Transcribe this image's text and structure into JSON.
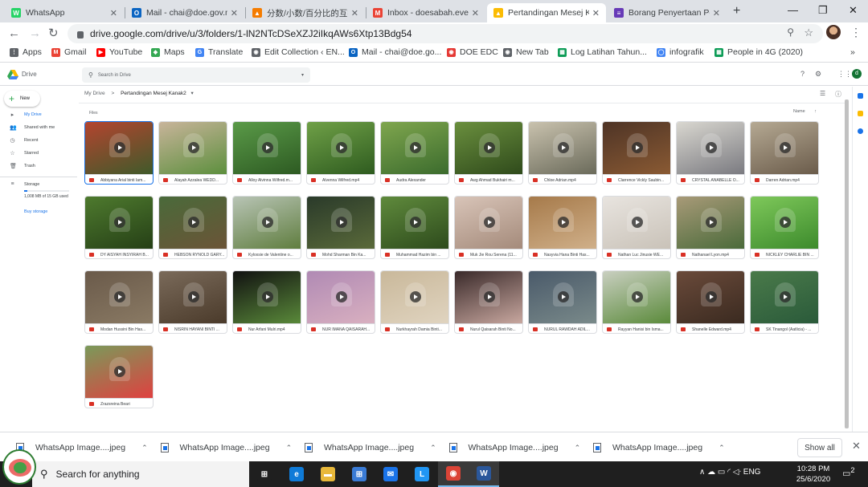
{
  "browser": {
    "tabs": [
      {
        "title": "WhatsApp",
        "icon_color": "#25d366",
        "icon_letter": "W",
        "active": false
      },
      {
        "title": "Mail - chai@doe.gov.m",
        "icon_color": "#0a64c2",
        "icon_letter": "O",
        "active": false
      },
      {
        "title": "分数/小数/百分比的互换",
        "icon_color": "#f57c00",
        "icon_letter": "▲",
        "active": false
      },
      {
        "title": "Inbox - doesabah.event",
        "icon_color": "#ea4335",
        "icon_letter": "M",
        "active": false
      },
      {
        "title": "Pertandingan Mesej Ka",
        "icon_color": "#fbbc04",
        "icon_letter": "▲",
        "active": true
      },
      {
        "title": "Borang Penyertaan Pert",
        "icon_color": "#673ab7",
        "icon_letter": "≡",
        "active": false
      }
    ],
    "new_tab_symbol": "+",
    "window_controls": {
      "minimize": "—",
      "restore": "❐",
      "close": "✕"
    },
    "url": "drive.google.com/drive/u/3/folders/1-lN2NTcDSeXZJ2iIkqAWs6Xtp13Bdg54",
    "bookmarks": [
      {
        "label": "Apps",
        "icon_color": "#5f6368",
        "icon_letter": "⋮"
      },
      {
        "label": "Gmail",
        "icon_color": "#ea4335",
        "icon_letter": "M"
      },
      {
        "label": "YouTube",
        "icon_color": "#ff0000",
        "icon_letter": "▶"
      },
      {
        "label": "Maps",
        "icon_color": "#34a853",
        "icon_letter": "◆"
      },
      {
        "label": "Translate",
        "icon_color": "#4285f4",
        "icon_letter": "G"
      },
      {
        "label": "Edit Collection ‹ EN...",
        "icon_color": "#5f6368",
        "icon_letter": "◉"
      },
      {
        "label": "Mail - chai@doe.go...",
        "icon_color": "#0a64c2",
        "icon_letter": "O"
      },
      {
        "label": "DOE EDC",
        "icon_color": "#e53935",
        "icon_letter": "◉"
      },
      {
        "label": "New Tab",
        "icon_color": "#5f6368",
        "icon_letter": "◉"
      },
      {
        "label": "Log Latihan Tahun...",
        "icon_color": "#0f9d58",
        "icon_letter": "▦"
      },
      {
        "label": "infografik",
        "icon_color": "#4285f4",
        "icon_letter": "◯"
      },
      {
        "label": "People in 4G (2020)",
        "icon_color": "#0f9d58",
        "icon_letter": "▦"
      }
    ],
    "bookmark_overflow": "»"
  },
  "drive": {
    "app_name": "Drive",
    "search_placeholder": "Search in Drive",
    "new_label": "New",
    "sidebar": [
      {
        "label": "My Drive",
        "icon": "▸"
      },
      {
        "label": "Shared with me",
        "icon": "👥"
      },
      {
        "label": "Recent",
        "icon": "◷"
      },
      {
        "label": "Starred",
        "icon": "☆"
      },
      {
        "label": "Trash",
        "icon": "🗑"
      }
    ],
    "storage_label": "Storage",
    "storage_used": "1,008 MB of 15 GB used",
    "storage_fraction": 0.07,
    "buy_storage": "Buy storage",
    "breadcrumb_root": "My Drive",
    "breadcrumb_sep": ">",
    "breadcrumb_current": "Pertandingan Mesej Kanak2",
    "breadcrumb_caret": "▾",
    "files_label": "Files",
    "sort_label": "Name",
    "sort_arrow": "↑",
    "account_letter": "d",
    "files": [
      {
        "name": "Abbiyana Arial binti Iam...",
        "colors": [
          "#b4442f",
          "#3f5a2a"
        ]
      },
      {
        "name": "Alayah Azzalea WEDD...",
        "colors": [
          "#c8b49a",
          "#5c8f3d"
        ]
      },
      {
        "name": "Alloy Alvinna Wilfred.m...",
        "colors": [
          "#5a9a48",
          "#2d5a22"
        ]
      },
      {
        "name": "Alvenna Wilfred.mp4",
        "colors": [
          "#6fa047",
          "#2e5b1f"
        ]
      },
      {
        "name": "Audra Alexander",
        "colors": [
          "#7fa64e",
          "#3b6b2d"
        ]
      },
      {
        "name": "Awg Ahmad Bukhairi m...",
        "colors": [
          "#6a8f3e",
          "#2f4a1b"
        ]
      },
      {
        "name": "Chloe Adrian.mp4",
        "colors": [
          "#c9c2ae",
          "#6a6a5a"
        ]
      },
      {
        "name": "Clarrence Vickly Saubin...",
        "colors": [
          "#4e3426",
          "#8a5a33"
        ]
      },
      {
        "name": "CRYSTAL ANABELLE O...",
        "colors": [
          "#d9d7d0",
          "#7a7a80"
        ]
      },
      {
        "name": "Darren Adrian.mp4",
        "colors": [
          "#b5a993",
          "#6a5b4a"
        ]
      },
      {
        "name": "DY AISYAH INSYIRAH B...",
        "colors": [
          "#4e7a2e",
          "#253f16"
        ]
      },
      {
        "name": "HEBSON RYNOLD GARY...",
        "colors": [
          "#4a6a3a",
          "#6b5437"
        ]
      },
      {
        "name": "Kyloxsie de Valentine o...",
        "colors": [
          "#b8c4b5",
          "#5f7d3e"
        ]
      },
      {
        "name": "Mohd Sharman Bin Ka...",
        "colors": [
          "#2a3a2a",
          "#5a6a3a"
        ]
      },
      {
        "name": "Muhammad Hazim bin ...",
        "colors": [
          "#5f8a3c",
          "#2d4a1c"
        ]
      },
      {
        "name": "Muk Jie Rou Serena (11...",
        "colors": [
          "#d8c4b8",
          "#a48a7a"
        ]
      },
      {
        "name": "Nasyvia Hana Binti Has...",
        "colors": [
          "#a67a4a",
          "#d0b08a"
        ]
      },
      {
        "name": "Nathan Luc Jinusie WE...",
        "colors": [
          "#e8e4df",
          "#c9c2b8"
        ]
      },
      {
        "name": "Nathanael Lyon.mp4",
        "colors": [
          "#a89a78",
          "#4a6a3a"
        ]
      },
      {
        "name": "NICKLEY CHARLIE BIN ...",
        "colors": [
          "#7ec85a",
          "#3c8a2c"
        ]
      },
      {
        "name": "Modan Hussini Bin Has...",
        "colors": [
          "#6a5a4a",
          "#8a7a64"
        ]
      },
      {
        "name": "NISRIN HAYANI BINTI ...",
        "colors": [
          "#7a6a5a",
          "#4a3a2a"
        ]
      },
      {
        "name": "Nur Arfani Mulri.mp4",
        "colors": [
          "#111111",
          "#5a8a3a"
        ]
      },
      {
        "name": "NUR IMANA QAISARAH...",
        "colors": [
          "#b08ab4",
          "#d9b0c0"
        ]
      },
      {
        "name": "Nurkhayrah Damia Binti...",
        "colors": [
          "#c9b89a",
          "#e0d4c0"
        ]
      },
      {
        "name": "Nurul Qaisarah Binti No...",
        "colors": [
          "#3a2a2a",
          "#c9a8a0"
        ]
      },
      {
        "name": "NURUL RAWDAH ADIL...",
        "colors": [
          "#4a5a6a",
          "#7a8a8a"
        ]
      },
      {
        "name": "Rayyan Hanisi bin Isma...",
        "colors": [
          "#c9cfc0",
          "#5a8a3a"
        ]
      },
      {
        "name": "Shanelle Edward.mp4",
        "colors": [
          "#6a4a3a",
          "#3a2a20"
        ]
      },
      {
        "name": "SK Tinangol (Aatlicia) - ...",
        "colors": [
          "#4a7a4a",
          "#2a5a3a"
        ]
      },
      {
        "name": "Zrazsreina Beari",
        "colors": [
          "#7a9a5a",
          "#e04040"
        ]
      }
    ]
  },
  "downloads": {
    "items": [
      "WhatsApp Image....jpeg",
      "WhatsApp Image....jpeg",
      "WhatsApp Image....jpeg",
      "WhatsApp Image....jpeg",
      "WhatsApp Image....jpeg"
    ],
    "chevron": "⌃",
    "show_all": "Show all",
    "close": "✕"
  },
  "taskbar": {
    "search_placeholder": "Search for anything",
    "apps": [
      {
        "letter": "⊞",
        "color": "#1f1f1f"
      },
      {
        "letter": "e",
        "color": "#0f7bd8"
      },
      {
        "letter": "▬",
        "color": "#e8b83a"
      },
      {
        "letter": "⊞",
        "color": "#3a7bd5"
      },
      {
        "letter": "✉",
        "color": "#1a73e8"
      },
      {
        "letter": "L",
        "color": "#2196f3"
      },
      {
        "letter": "◉",
        "color": "#db4437"
      },
      {
        "letter": "W",
        "color": "#2b579a"
      }
    ],
    "tray": "∧  ☁  ▭  ◜  ◁ᐧ  ENG",
    "time": "10:28 PM",
    "date": "25/6/2020",
    "notif": "2"
  }
}
